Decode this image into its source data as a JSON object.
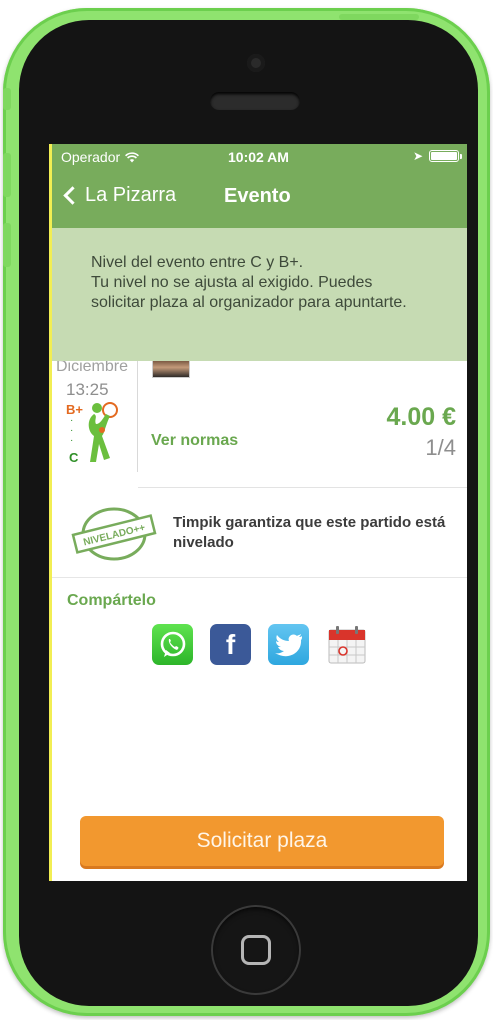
{
  "status_bar": {
    "carrier": "Operador",
    "time": "10:02 AM"
  },
  "nav": {
    "back_label": "La Pizarra",
    "title": "Evento"
  },
  "alert": {
    "line1": "Nivel del evento entre C y B+.",
    "line2": "Tu nivel no se ajusta al exigido. Puedes solicitar plaza al organizador para apuntarte."
  },
  "event": {
    "month": "Diciembre",
    "time": "13:25",
    "level_max": "B+",
    "level_min": "C",
    "rules_link": "Ver normas",
    "price": "4.00 €",
    "slots": "1/4"
  },
  "guarantee": {
    "badge_text": "NIVELADO++",
    "text": "Timpik garantiza que este partido está nivelado"
  },
  "share": {
    "title": "Compártelo",
    "facebook_glyph": "f"
  },
  "cta": {
    "label": "Solicitar plaza"
  },
  "colors": {
    "brand_green": "#78ac5c",
    "accent_green": "#6aa84f",
    "banner_bg": "#c6dbb3",
    "cta_orange": "#f2982f",
    "phone_green": "#8fe36f"
  }
}
